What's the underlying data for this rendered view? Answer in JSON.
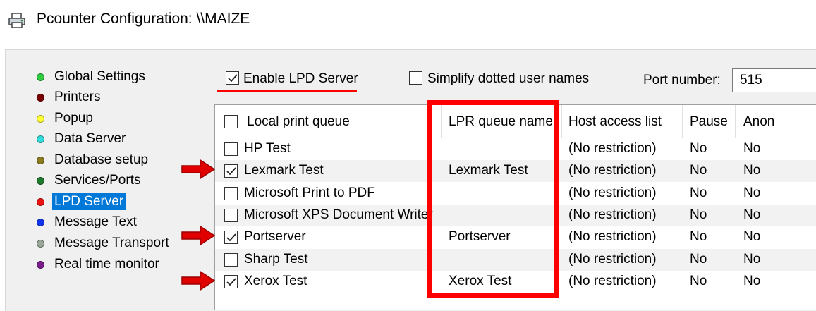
{
  "window": {
    "title": "Pcounter Configuration: \\\\MAIZE",
    "icon": "printer-icon"
  },
  "nav": {
    "items": [
      {
        "label": "Global Settings",
        "color": "#2ecc40",
        "selected": false
      },
      {
        "label": "Printers",
        "color": "#7a0000",
        "selected": false
      },
      {
        "label": "Popup",
        "color": "#ffff33",
        "selected": false
      },
      {
        "label": "Data Server",
        "color": "#33dddd",
        "selected": false
      },
      {
        "label": "Database setup",
        "color": "#8b7a1e",
        "selected": false
      },
      {
        "label": "Services/Ports",
        "color": "#1e7a2e",
        "selected": false
      },
      {
        "label": "LPD Server",
        "color": "#ee1111",
        "selected": true
      },
      {
        "label": "Message Text",
        "color": "#1133ee",
        "selected": false
      },
      {
        "label": "Message Transport",
        "color": "#9aa89a",
        "selected": false
      },
      {
        "label": "Real time monitor",
        "color": "#7a1e8b",
        "selected": false
      }
    ]
  },
  "options": {
    "enable_lpd_label": "Enable LPD Server",
    "enable_lpd_checked": true,
    "simplify_label": "Simplify dotted user names",
    "simplify_checked": false,
    "port_label": "Port number:",
    "port_value": "515"
  },
  "table": {
    "columns": [
      "Local print queue",
      "LPR queue name",
      "Host access list",
      "Pause",
      "Anon"
    ],
    "rows": [
      {
        "checked": false,
        "queue": "HP Test",
        "lpr": "",
        "host": "(No restriction)",
        "pause": "No",
        "anon": "No"
      },
      {
        "checked": true,
        "queue": "Lexmark Test",
        "lpr": "Lexmark Test",
        "host": "(No restriction)",
        "pause": "No",
        "anon": "No"
      },
      {
        "checked": false,
        "queue": "Microsoft Print to PDF",
        "lpr": "",
        "host": "(No restriction)",
        "pause": "No",
        "anon": "No"
      },
      {
        "checked": false,
        "queue": "Microsoft XPS Document Writer",
        "lpr": "",
        "host": "(No restriction)",
        "pause": "No",
        "anon": "No"
      },
      {
        "checked": true,
        "queue": "Portserver",
        "lpr": "Portserver",
        "host": "(No restriction)",
        "pause": "No",
        "anon": "No"
      },
      {
        "checked": false,
        "queue": "Sharp Test",
        "lpr": "",
        "host": "(No restriction)",
        "pause": "No",
        "anon": "No"
      },
      {
        "checked": true,
        "queue": "Xerox Test",
        "lpr": "Xerox Test",
        "host": "(No restriction)",
        "pause": "No",
        "anon": "No"
      }
    ]
  },
  "annotations": {
    "color": "#ff0000",
    "arrow_icon": "red-arrow-icon"
  }
}
